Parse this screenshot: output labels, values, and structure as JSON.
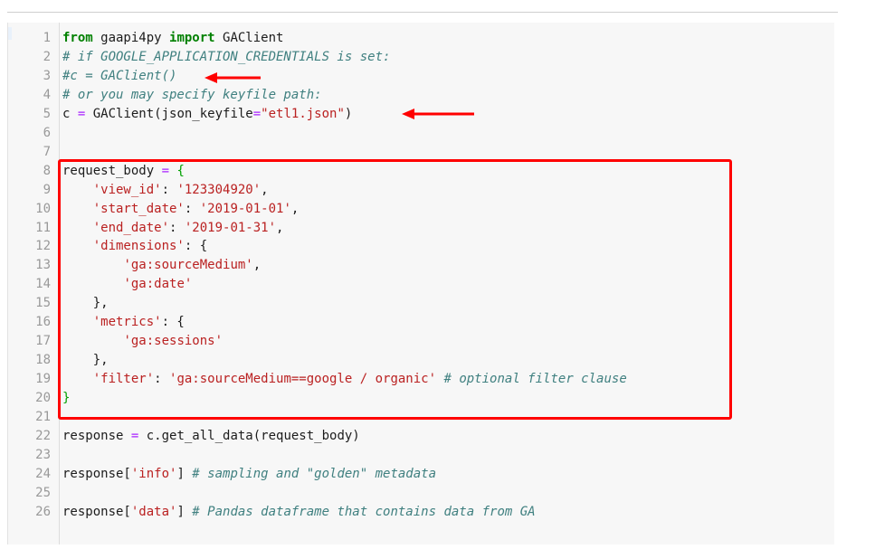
{
  "editor": {
    "lines": [
      {
        "n": "1",
        "parts": [
          {
            "t": "from",
            "c": "kw"
          },
          {
            "t": " gaapi4py "
          },
          {
            "t": "import",
            "c": "kw"
          },
          {
            "t": " GAClient"
          }
        ]
      },
      {
        "n": "2",
        "parts": [
          {
            "t": "# if GOOGLE_APPLICATION_CREDENTIALS is set:",
            "c": "cm"
          }
        ]
      },
      {
        "n": "3",
        "parts": [
          {
            "t": "#c = GAClient()",
            "c": "cm"
          }
        ]
      },
      {
        "n": "4",
        "parts": [
          {
            "t": "# or you may specify keyfile path:",
            "c": "cm"
          }
        ]
      },
      {
        "n": "5",
        "parts": [
          {
            "t": "c "
          },
          {
            "t": "=",
            "c": "op"
          },
          {
            "t": " GAClient(json_keyfile"
          },
          {
            "t": "=",
            "c": "op"
          },
          {
            "t": "\"etl1.json\"",
            "c": "st"
          },
          {
            "t": ")"
          }
        ]
      },
      {
        "n": "6",
        "parts": []
      },
      {
        "n": "7",
        "parts": []
      },
      {
        "n": "8",
        "parts": [
          {
            "t": "request_body "
          },
          {
            "t": "=",
            "c": "op"
          },
          {
            "t": " "
          },
          {
            "t": "{",
            "c": "brk"
          }
        ]
      },
      {
        "n": "9",
        "parts": [
          {
            "t": "    "
          },
          {
            "t": "'view_id'",
            "c": "st"
          },
          {
            "t": ": "
          },
          {
            "t": "'123304920'",
            "c": "st"
          },
          {
            "t": ","
          }
        ]
      },
      {
        "n": "10",
        "parts": [
          {
            "t": "    "
          },
          {
            "t": "'start_date'",
            "c": "st"
          },
          {
            "t": ": "
          },
          {
            "t": "'2019-01-01'",
            "c": "st"
          },
          {
            "t": ","
          }
        ]
      },
      {
        "n": "11",
        "parts": [
          {
            "t": "    "
          },
          {
            "t": "'end_date'",
            "c": "st"
          },
          {
            "t": ": "
          },
          {
            "t": "'2019-01-31'",
            "c": "st"
          },
          {
            "t": ","
          }
        ]
      },
      {
        "n": "12",
        "parts": [
          {
            "t": "    "
          },
          {
            "t": "'dimensions'",
            "c": "st"
          },
          {
            "t": ": {"
          }
        ]
      },
      {
        "n": "13",
        "parts": [
          {
            "t": "        "
          },
          {
            "t": "'ga:sourceMedium'",
            "c": "st"
          },
          {
            "t": ","
          }
        ]
      },
      {
        "n": "14",
        "parts": [
          {
            "t": "        "
          },
          {
            "t": "'ga:date'",
            "c": "st"
          }
        ]
      },
      {
        "n": "15",
        "parts": [
          {
            "t": "    },"
          }
        ]
      },
      {
        "n": "16",
        "parts": [
          {
            "t": "    "
          },
          {
            "t": "'metrics'",
            "c": "st"
          },
          {
            "t": ": {"
          }
        ]
      },
      {
        "n": "17",
        "parts": [
          {
            "t": "        "
          },
          {
            "t": "'ga:sessions'",
            "c": "st"
          }
        ]
      },
      {
        "n": "18",
        "parts": [
          {
            "t": "    },"
          }
        ]
      },
      {
        "n": "19",
        "parts": [
          {
            "t": "    "
          },
          {
            "t": "'filter'",
            "c": "st"
          },
          {
            "t": ": "
          },
          {
            "t": "'ga:sourceMedium==google / organic'",
            "c": "st"
          },
          {
            "t": " "
          },
          {
            "t": "# optional filter clause",
            "c": "cm"
          }
        ]
      },
      {
        "n": "20",
        "parts": [
          {
            "t": "}",
            "c": "brk"
          }
        ]
      },
      {
        "n": "21",
        "parts": []
      },
      {
        "n": "22",
        "parts": [
          {
            "t": "response "
          },
          {
            "t": "=",
            "c": "op"
          },
          {
            "t": " c.get_all_data(request_body)"
          }
        ]
      },
      {
        "n": "23",
        "parts": []
      },
      {
        "n": "24",
        "parts": [
          {
            "t": "response["
          },
          {
            "t": "'info'",
            "c": "st"
          },
          {
            "t": "] "
          },
          {
            "t": "# sampling and \"golden\" metadata",
            "c": "cm"
          }
        ]
      },
      {
        "n": "25",
        "parts": []
      },
      {
        "n": "26",
        "parts": [
          {
            "t": "response["
          },
          {
            "t": "'data'",
            "c": "st"
          },
          {
            "t": "] "
          },
          {
            "t": "# Pandas dataframe that contains data from GA",
            "c": "cm"
          }
        ]
      }
    ]
  },
  "annotations": {
    "box_color": "#ff0000",
    "arrow_color": "#ff0000"
  }
}
